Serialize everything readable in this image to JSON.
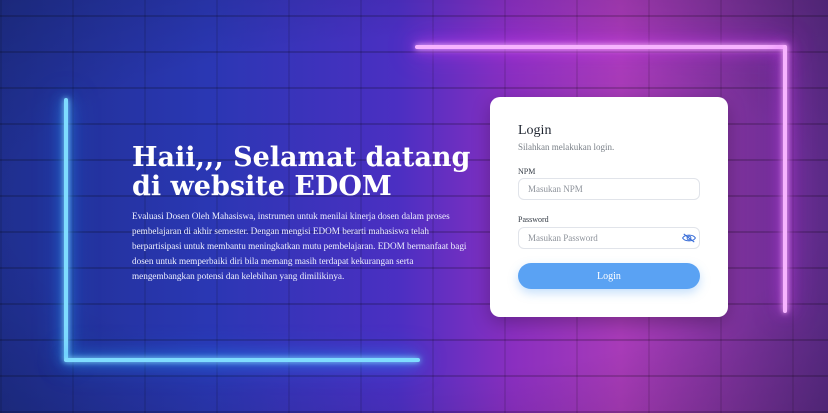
{
  "hero": {
    "title": "Haii,,, Selamat datang di website EDOM",
    "description": "Evaluasi Dosen Oleh Mahasiswa, instrumen untuk menilai kinerja dosen dalam proses pembelajaran di akhir semester. Dengan mengisi EDOM berarti mahasiswa telah berpartisipasi untuk membantu meningkatkan mutu pembelajaran. EDOM bermanfaat bagi dosen untuk memperbaiki diri bila memang masih terdapat kekurangan serta mengembangkan potensi dan kelebihan yang dimilikinya."
  },
  "login": {
    "title": "Login",
    "subtitle": "Silahkan melakukan login.",
    "npm_label": "NPM",
    "npm_placeholder": "Masukan NPM",
    "password_label": "Password",
    "password_placeholder": "Masukan Password",
    "submit_label": "Login",
    "toggle_icon": "eye-slash-icon"
  },
  "colors": {
    "accent": "#5aa2f3",
    "neon_blue": "#7fdcff",
    "neon_pink": "#f7b3ff"
  }
}
